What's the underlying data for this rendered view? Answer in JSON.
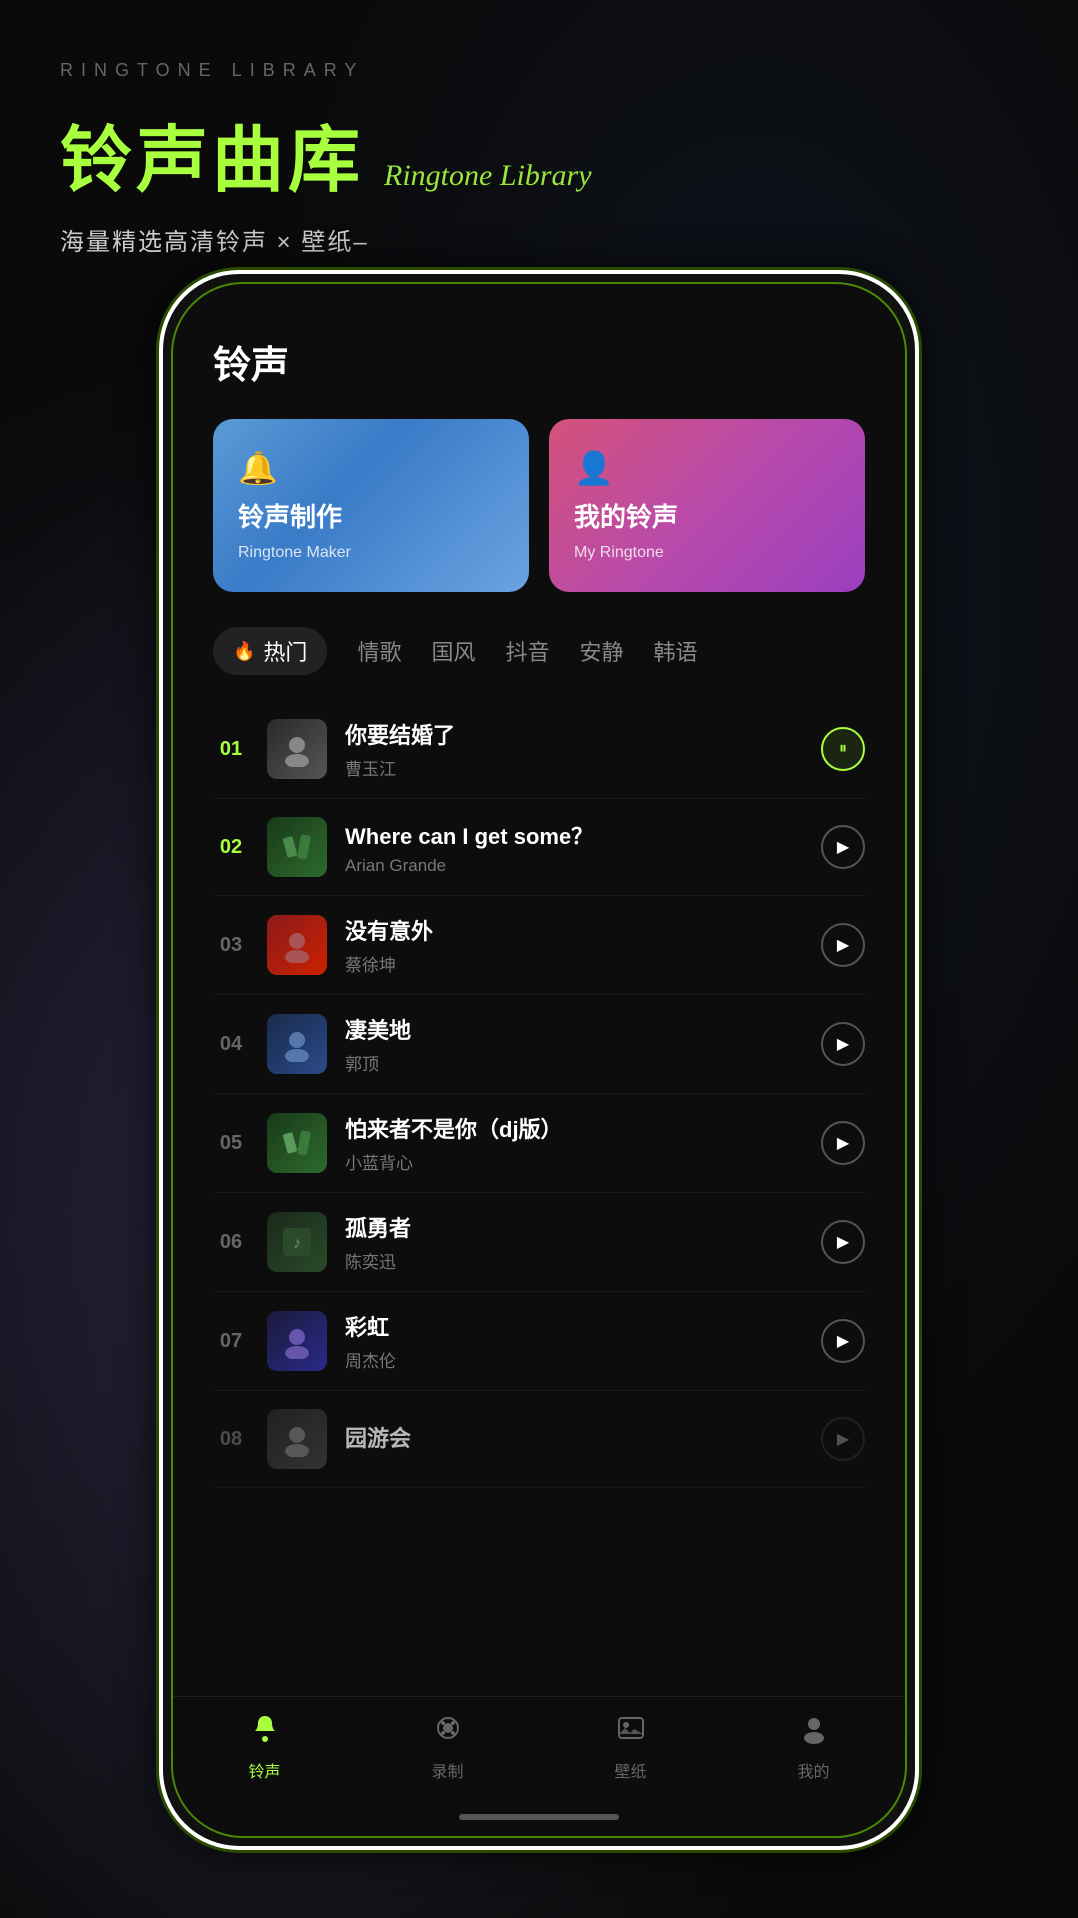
{
  "header": {
    "subtitle": "RINGTONE LIBRARY",
    "title_chinese": "铃声曲库",
    "title_english": "Ringtone Library",
    "description": "海量精选高清铃声 × 壁纸–"
  },
  "phone": {
    "page_title": "铃声",
    "cards": [
      {
        "id": "maker",
        "icon": "🔔",
        "title_zh": "铃声制作",
        "title_en": "Ringtone Maker",
        "style": "maker"
      },
      {
        "id": "my",
        "icon": "👤",
        "title_zh": "我的铃声",
        "title_en": "My Ringtone",
        "style": "my"
      }
    ],
    "tabs": [
      {
        "id": "hot",
        "label": "热门",
        "active": true
      },
      {
        "id": "love",
        "label": "情歌",
        "active": false
      },
      {
        "id": "guofeng",
        "label": "国风",
        "active": false
      },
      {
        "id": "douyin",
        "label": "抖音",
        "active": false
      },
      {
        "id": "quiet",
        "label": "安静",
        "active": false
      },
      {
        "id": "korean",
        "label": "韩语",
        "active": false
      }
    ],
    "songs": [
      {
        "number": "01",
        "title": "你要结婚了",
        "artist": "曹玉江",
        "playing": true,
        "highlighted": true,
        "thumb": "thumb-1",
        "thumb_emoji": "👨"
      },
      {
        "number": "02",
        "title": "Where can I get some？",
        "artist": "Arian Grande",
        "playing": false,
        "highlighted": true,
        "thumb": "thumb-2",
        "thumb_emoji": "🎵"
      },
      {
        "number": "03",
        "title": "没有意外",
        "artist": "蔡徐坤",
        "playing": false,
        "highlighted": false,
        "thumb": "thumb-3",
        "thumb_emoji": "👨"
      },
      {
        "number": "04",
        "title": "凄美地",
        "artist": "郭顶",
        "playing": false,
        "highlighted": false,
        "thumb": "thumb-4",
        "thumb_emoji": "👨"
      },
      {
        "number": "05",
        "title": "怕来者不是你（dj版）",
        "artist": "小蓝背心",
        "playing": false,
        "highlighted": false,
        "thumb": "thumb-5",
        "thumb_emoji": "🎵"
      },
      {
        "number": "06",
        "title": "孤勇者",
        "artist": "陈奕迅",
        "playing": false,
        "highlighted": false,
        "thumb": "thumb-6",
        "thumb_emoji": "🎵"
      },
      {
        "number": "07",
        "title": "彩虹",
        "artist": "周杰伦",
        "playing": false,
        "highlighted": false,
        "thumb": "thumb-7",
        "thumb_emoji": "👨"
      },
      {
        "number": "08",
        "title": "园游会",
        "artist": "",
        "playing": false,
        "highlighted": false,
        "thumb": "thumb-8",
        "thumb_emoji": "🎵"
      }
    ],
    "nav": [
      {
        "id": "ringtone",
        "label": "铃声",
        "active": true,
        "icon": "🔔"
      },
      {
        "id": "record",
        "label": "录制",
        "active": false,
        "icon": "⚙️"
      },
      {
        "id": "wallpaper",
        "label": "壁纸",
        "active": false,
        "icon": "🖼️"
      },
      {
        "id": "mine",
        "label": "我的",
        "active": false,
        "icon": "👤"
      }
    ]
  }
}
